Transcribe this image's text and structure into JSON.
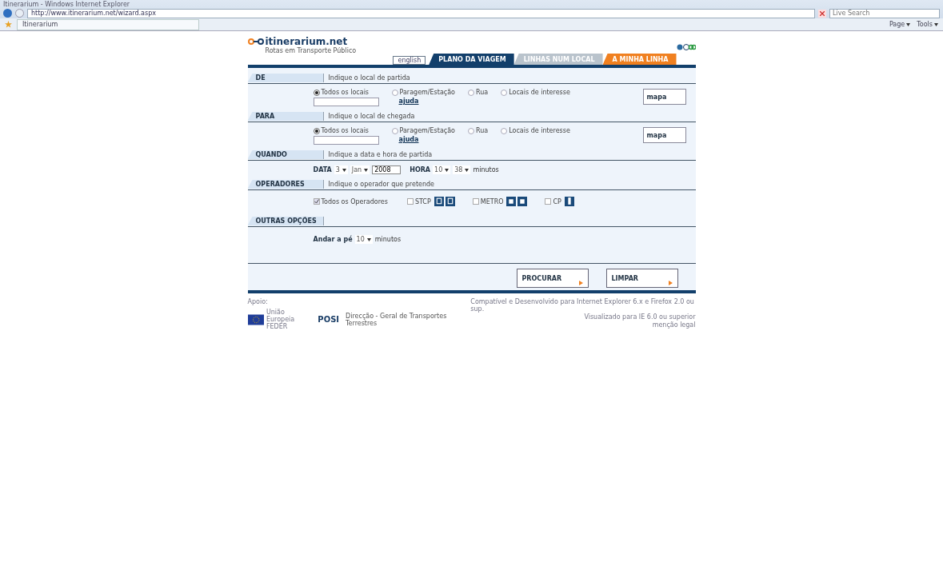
{
  "browser": {
    "title": "Itinerarium - Windows Internet Explorer",
    "address": "http://www.itinerarium.net/wizard.aspx",
    "tab": "Itinerarium",
    "search": {
      "placeholder": "Live Search"
    },
    "toolbar": [
      "Page",
      "Tools"
    ]
  },
  "site": {
    "logo": "itinerarium.net",
    "tagline": "Rotas em Transporte Público"
  },
  "tabs": [
    {
      "label": "english",
      "kind": "lang",
      "selected": false
    },
    {
      "label": "PLANO DA VIAGEM",
      "kind": "main",
      "selected": true
    },
    {
      "label": "LINHAS NUM LOCAL",
      "kind": "main",
      "selected": false
    },
    {
      "label": "A MINHA LINHA",
      "kind": "accent",
      "selected": false
    }
  ],
  "sections": [
    {
      "kind": "place",
      "title": "DE",
      "hint": "Indique o local de partida",
      "options": [
        {
          "label": "Todos os locais",
          "selected": true
        },
        {
          "label": "Paragem/Estação",
          "selected": false
        },
        {
          "label": "Rua",
          "selected": false
        },
        {
          "label": "Locais de interesse",
          "selected": false
        }
      ],
      "help": "ajuda",
      "map_button": "mapa"
    },
    {
      "kind": "place",
      "title": "PARA",
      "hint": "Indique o local de chegada",
      "options": [
        {
          "label": "Todos os locais",
          "selected": true
        },
        {
          "label": "Paragem/Estação",
          "selected": false
        },
        {
          "label": "Rua",
          "selected": false
        },
        {
          "label": "Locais de interesse",
          "selected": false
        }
      ],
      "help": "ajuda",
      "map_button": "mapa"
    },
    {
      "kind": "when",
      "title": "QUANDO",
      "hint": "Indique a data e hora de partida",
      "date_label": "DATA",
      "day": "3",
      "month": "Jan",
      "year": "2008",
      "hour_label": "HORA",
      "hour": "10",
      "minute": "38",
      "unit": "minutos"
    },
    {
      "kind": "operators",
      "title": "OPERADORES",
      "hint": "Indique o operador que pretende",
      "operators": [
        {
          "label": "Todos os Operadores",
          "checked": true
        },
        {
          "label": "STCP",
          "checked": false
        },
        {
          "label": "METRO",
          "checked": false
        },
        {
          "label": "CP",
          "checked": false
        }
      ]
    },
    {
      "kind": "other",
      "title": "OUTRAS OPÇÕES",
      "walk_label": "Andar a pé",
      "walk": "10",
      "unit": "minutos"
    }
  ],
  "actions": [
    "PROCURAR",
    "LIMPAR"
  ],
  "footer": {
    "support": "Apoio:",
    "eu": "União Europeia",
    "feder": "FEDER",
    "posi": "POSI",
    "dgtt": "Direcção - Geral de Transportes Terrestres",
    "notes": [
      "Compatível e Desenvolvido para Internet Explorer 6.x e Firefox 2.0 ou sup.",
      "Visualizado para IE 6.0 ou superior",
      "menção legal"
    ]
  }
}
